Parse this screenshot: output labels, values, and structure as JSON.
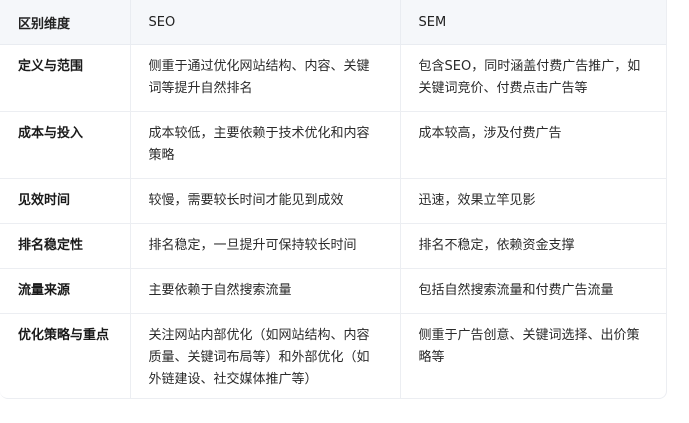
{
  "table": {
    "headers": [
      "区别维度",
      "SEO",
      "SEM"
    ],
    "rows": [
      {
        "dimension": "定义与范围",
        "seo": "侧重于通过优化网站结构、内容、关键词等提升自然排名",
        "sem": "包含SEO，同时涵盖付费广告推广，如关键词竞价、付费点击广告等"
      },
      {
        "dimension": "成本与投入",
        "seo": "成本较低，主要依赖于技术优化和内容策略",
        "sem": "成本较高，涉及付费广告"
      },
      {
        "dimension": "见效时间",
        "seo": "较慢，需要较长时间才能见到成效",
        "sem": "迅速，效果立竿见影"
      },
      {
        "dimension": "排名稳定性",
        "seo": "排名稳定，一旦提升可保持较长时间",
        "sem": "排名不稳定，依赖资金支撑"
      },
      {
        "dimension": "流量来源",
        "seo": "主要依赖于自然搜索流量",
        "sem": "包括自然搜索流量和付费广告流量"
      },
      {
        "dimension": "优化策略与重点",
        "seo": "关注网站内部优化（如网站结构、内容质量、关键词布局等）和外部优化（如外链建设、社交媒体推广等）",
        "sem": "侧重于广告创意、关键词选择、出价策略等"
      }
    ]
  }
}
